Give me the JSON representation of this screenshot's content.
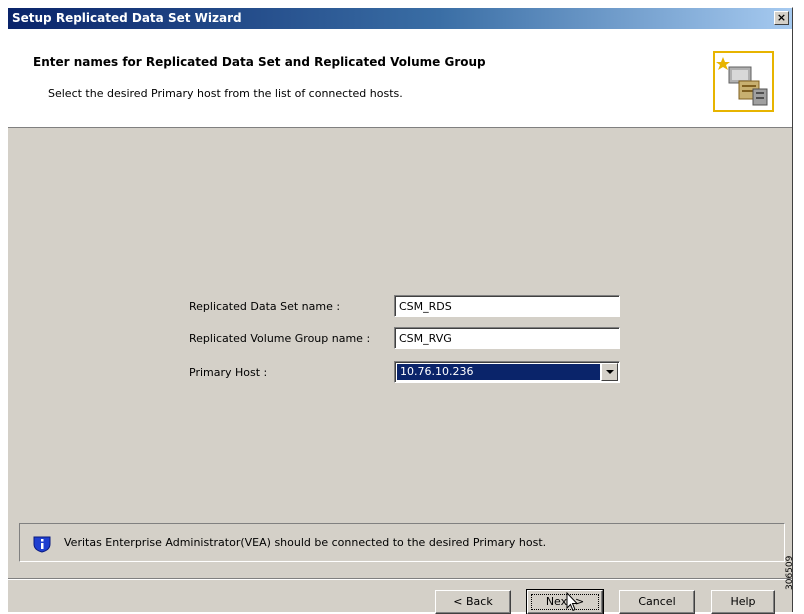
{
  "window": {
    "title": "Setup Replicated Data Set Wizard",
    "close_label": "×"
  },
  "header": {
    "title": "Enter names for Replicated Data Set and Replicated Volume Group",
    "subtitle": "Select the desired Primary host from the list of connected hosts.",
    "icon": "wizard-server-icon"
  },
  "form": {
    "rds_label": "Replicated Data Set name :",
    "rds_value": "CSM_RDS",
    "rvg_label": "Replicated Volume Group name :",
    "rvg_value": "CSM_RVG",
    "host_label": "Primary Host :",
    "host_value": "10.76.10.236"
  },
  "info": {
    "icon": "info-icon",
    "text": "Veritas Enterprise Administrator(VEA) should be connected to the desired Primary host."
  },
  "buttons": {
    "back": "< Back",
    "next": "Next >",
    "cancel": "Cancel",
    "help": "Help"
  },
  "side_number": "306509",
  "colors": {
    "titlebar": "#0a246a",
    "dialog_bg": "#d4d0c8",
    "selection": "#0a246a",
    "icon_border": "#e7b400"
  }
}
